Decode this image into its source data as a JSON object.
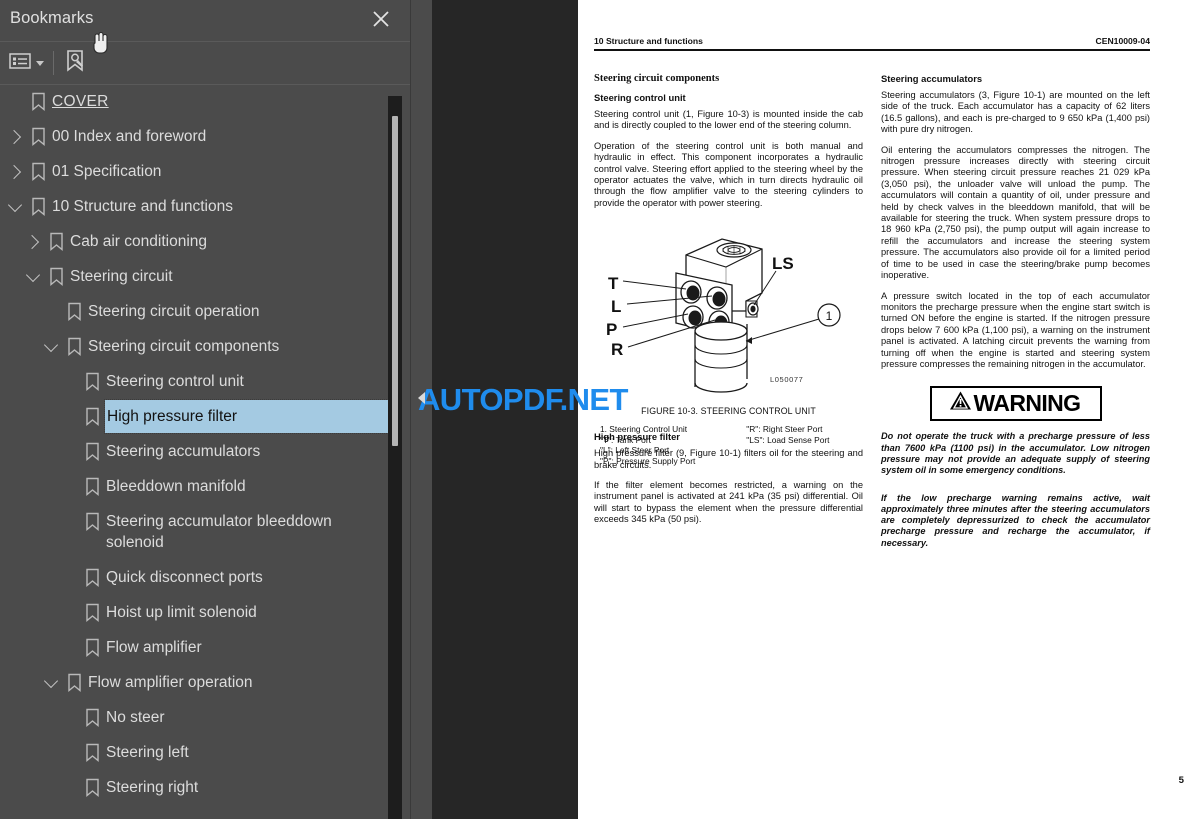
{
  "panel": {
    "title": "Bookmarks",
    "close_icon": "close-icon",
    "toolbar": {
      "options_icon": "list-options-icon",
      "options_chevron_icon": "chevron-down-icon",
      "find_icon": "find-bookmark-icon"
    }
  },
  "bookmarks": [
    {
      "label": "COVER",
      "level": 1,
      "twisty": "none",
      "style": "cover",
      "selected": false
    },
    {
      "label": "00 Index and foreword",
      "level": 1,
      "twisty": "collapsed",
      "style": "normal",
      "selected": false
    },
    {
      "label": "01 Specification",
      "level": 1,
      "twisty": "collapsed",
      "style": "normal",
      "selected": false
    },
    {
      "label": "10 Structure and functions",
      "level": 1,
      "twisty": "expanded",
      "style": "normal",
      "selected": false
    },
    {
      "label": "Cab air conditioning",
      "level": 2,
      "twisty": "collapsed",
      "style": "normal",
      "selected": false
    },
    {
      "label": "Steering circuit",
      "level": 2,
      "twisty": "expanded",
      "style": "normal",
      "selected": false
    },
    {
      "label": "Steering circuit operation",
      "level": 3,
      "twisty": "none",
      "style": "normal",
      "selected": false
    },
    {
      "label": "Steering circuit components",
      "level": 3,
      "twisty": "expanded",
      "style": "normal",
      "selected": false
    },
    {
      "label": "Steering control unit",
      "level": 4,
      "twisty": "none",
      "style": "normal",
      "selected": false
    },
    {
      "label": "High pressure filter",
      "level": 4,
      "twisty": "none",
      "style": "normal",
      "selected": true
    },
    {
      "label": "Steering accumulators",
      "level": 4,
      "twisty": "none",
      "style": "normal",
      "selected": false
    },
    {
      "label": "Bleeddown manifold",
      "level": 4,
      "twisty": "none",
      "style": "normal",
      "selected": false
    },
    {
      "label": "Steering accumulator bleeddown solenoid",
      "level": 4,
      "twisty": "none",
      "style": "normal",
      "selected": false
    },
    {
      "label": "Quick disconnect ports",
      "level": 4,
      "twisty": "none",
      "style": "normal",
      "selected": false
    },
    {
      "label": "Hoist up limit solenoid",
      "level": 4,
      "twisty": "none",
      "style": "normal",
      "selected": false
    },
    {
      "label": "Flow amplifier",
      "level": 4,
      "twisty": "none",
      "style": "normal",
      "selected": false
    },
    {
      "label": "Flow amplifier operation",
      "level": 3,
      "twisty": "expanded",
      "style": "normal",
      "selected": false
    },
    {
      "label": "No steer",
      "level": 4,
      "twisty": "none",
      "style": "normal",
      "selected": false
    },
    {
      "label": "Steering left",
      "level": 4,
      "twisty": "none",
      "style": "normal",
      "selected": false
    },
    {
      "label": "Steering right",
      "level": 4,
      "twisty": "none",
      "style": "normal",
      "selected": false
    }
  ],
  "watermark": {
    "text": "AUTOPDF.NET",
    "color": "#1f8ced"
  },
  "document": {
    "header_left": "10 Structure and functions",
    "header_right": "CEN10009-04",
    "page_number": "5",
    "left_column": {
      "section_heading": "Steering circuit components",
      "sub1": "Steering control unit",
      "p1": "Steering control unit (1, Figure 10-3) is mounted inside the cab and is directly coupled to the lower end of the steering column.",
      "p2": "Operation of the steering control unit is both manual and hydraulic in effect. This component incorporates a hydraulic control valve. Steering effort applied to the steering wheel by the operator actuates the valve, which in turn directs hydraulic oil through the flow amplifier valve to the steering cylinders to provide the operator with power steering.",
      "figure": {
        "caption": "FIGURE 10-3. STEERING CONTROL UNIT",
        "drawing_code": "L050077",
        "callout_number": "1",
        "port_labels": [
          "T",
          "L",
          "P",
          "R",
          "LS"
        ],
        "legend_col1": [
          "1. Steering Control Unit",
          "\"T\": Tank Port",
          "\"L\": Left Steer Port",
          "\"P\": Pressure Supply Port"
        ],
        "legend_col2": [
          "\"R\": Right Steer Port",
          "\"LS\": Load Sense Port"
        ]
      },
      "sub2": "High pressure filter",
      "p3": "High pressure filter (9, Figure 10-1) filters oil for the steering and brake circuits.",
      "p4": "If the filter element becomes restricted, a warning on the instrument panel is activated at 241 kPa (35 psi) differential. Oil will start to bypass the element when the pressure differential exceeds 345 kPa (50 psi)."
    },
    "right_column": {
      "sub1": "Steering accumulators",
      "p1": "Steering accumulators (3, Figure 10-1) are mounted on the left side of the truck. Each accumulator has a capacity of 62 liters (16.5 gallons), and each is pre-charged to 9 650 kPa (1,400 psi) with pure dry nitrogen.",
      "p2": "Oil entering the accumulators compresses the nitrogen. The nitrogen pressure increases directly with steering circuit pressure. When steering circuit pressure reaches 21 029 kPa (3,050 psi), the unloader valve will unload the pump. The accumulators will contain a quantity of oil, under pressure and held by check valves in the bleeddown manifold, that will be available for steering the truck. When system pressure drops to 18 960 kPa (2,750 psi), the pump output will again increase to refill the accumulators and increase the steering system pressure. The accumulators also provide oil for a limited period of time to be used in case the steering/brake pump becomes inoperative.",
      "p3": "A pressure switch located in the top of each accumulator monitors the precharge pressure when the engine start switch is turned ON before the engine is started. If the nitrogen pressure drops below 7 600 kPa (1,100 psi), a warning on the instrument panel is activated. A latching circuit prevents the warning from turning off when the engine is started and steering system pressure compresses the remaining nitrogen in the accumulator.",
      "warning_label": "WARNING",
      "warning_icon": "warning-triangle-icon",
      "warn1": "Do not operate the truck with a precharge pressure of less than 7600 kPa (1100 psi) in the accumulator. Low nitrogen pressure may not provide an adequate supply of steering system oil in some emergency conditions.",
      "warn2": "If the low precharge warning remains active, wait approximately three minutes after the steering accumulators are completely depressurized to check the accumulator precharge pressure and recharge the accumulator, if necessary."
    }
  }
}
